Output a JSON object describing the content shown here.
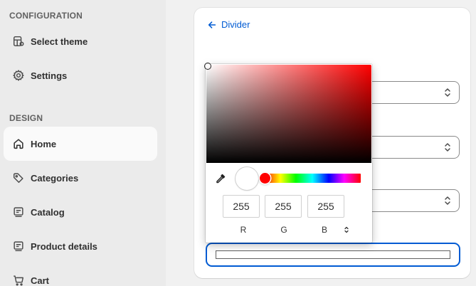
{
  "sidebar": {
    "configuration_title": "CONFIGURATION",
    "design_title": "DESIGN",
    "config_items": [
      {
        "label": "Select theme",
        "icon": "theme-icon"
      },
      {
        "label": "Settings",
        "icon": "gear-icon"
      }
    ],
    "design_items": [
      {
        "label": "Home",
        "icon": "home-icon",
        "active": true
      },
      {
        "label": "Categories",
        "icon": "tag-icon"
      },
      {
        "label": "Catalog",
        "icon": "catalog-icon"
      },
      {
        "label": "Product details",
        "icon": "product-icon"
      },
      {
        "label": "Cart",
        "icon": "cart-icon"
      }
    ]
  },
  "main": {
    "back_label": "Divider",
    "accent_color": "#005bd3"
  },
  "color_picker": {
    "hex": "#ffffff",
    "hue_color": "#ff0000",
    "r": "255",
    "g": "255",
    "b": "255",
    "r_label": "R",
    "g_label": "G",
    "b_label": "B"
  }
}
